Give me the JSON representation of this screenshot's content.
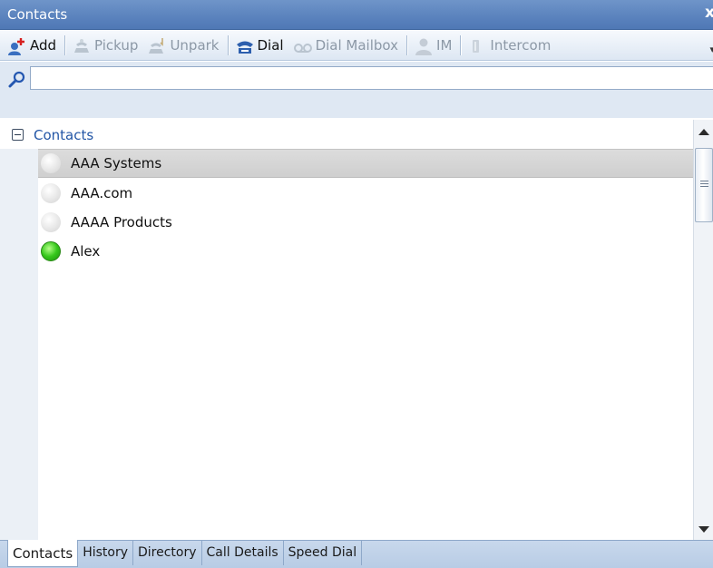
{
  "window": {
    "title": "Contacts",
    "close_glyph": "x"
  },
  "toolbar": {
    "buttons": [
      {
        "label": "Add",
        "icon": "add-contact-icon",
        "enabled": true
      },
      {
        "label": "Pickup",
        "icon": "pickup-icon",
        "enabled": false
      },
      {
        "label": "Unpark",
        "icon": "unpark-icon",
        "enabled": false
      },
      {
        "label": "Dial",
        "icon": "phone-icon",
        "enabled": true
      },
      {
        "label": "Dial Mailbox",
        "icon": "voicemail-icon",
        "enabled": false
      },
      {
        "label": "IM",
        "icon": "person-icon",
        "enabled": false
      },
      {
        "label": "Intercom",
        "icon": "speaker-icon",
        "enabled": false
      }
    ],
    "overflow_glyph": "▾"
  },
  "search": {
    "value": "",
    "placeholder": ""
  },
  "tree": {
    "group_label": "Contacts",
    "expander_state": "expanded",
    "contacts": [
      {
        "name": "AAA Systems",
        "status": "offline",
        "selected": true
      },
      {
        "name": "AAA.com",
        "status": "offline",
        "selected": false
      },
      {
        "name": "AAAA Products",
        "status": "offline",
        "selected": false
      },
      {
        "name": "Alex",
        "status": "online",
        "selected": false
      }
    ]
  },
  "tabs": [
    {
      "label": "Contacts",
      "active": true
    },
    {
      "label": "History",
      "active": false
    },
    {
      "label": "Directory",
      "active": false
    },
    {
      "label": "Call Details",
      "active": false
    },
    {
      "label": "Speed Dial",
      "active": false
    }
  ],
  "colors": {
    "titlebar": "#5a82bd",
    "group_label": "#2356a6",
    "online": "#35c71b",
    "selected_row": "#d5d5d5"
  }
}
